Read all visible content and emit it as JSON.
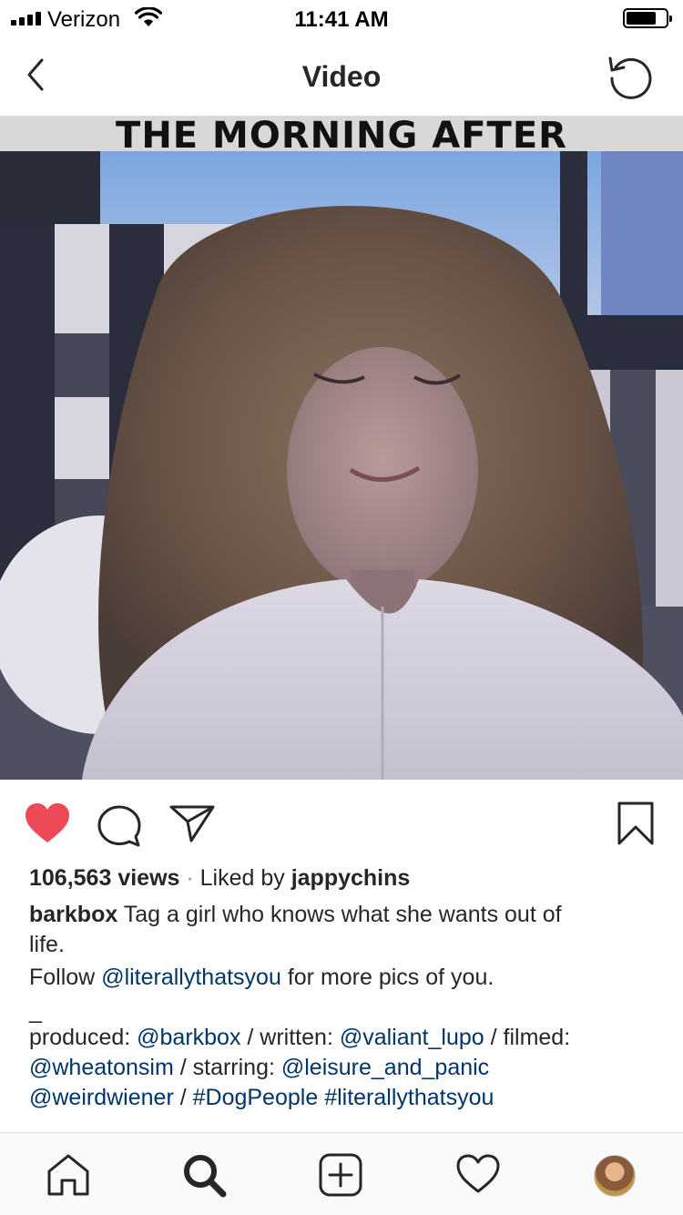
{
  "status_bar": {
    "carrier": "Verizon",
    "time": "11:41 AM",
    "battery_level": 0.75
  },
  "nav": {
    "title": "Video",
    "back_icon": "chevron-left-icon",
    "replay_icon": "replay-icon"
  },
  "video": {
    "title_text": "THE MORNING AFTER"
  },
  "post": {
    "liked": true,
    "like_color": "#ed4956",
    "views": "106,563 views",
    "separator": " · ",
    "liked_by_prefix": "Liked by ",
    "liked_by_user": "jappychins",
    "author": "barkbox",
    "caption_line1": " Tag a girl who knows what she wants out of",
    "caption_line2": "life.",
    "follow_prefix": "Follow ",
    "follow_handle": "@literallythatsyou",
    "follow_suffix": " for more pics of you.",
    "dash": "_",
    "produced_label": "produced: ",
    "produced_handle": "@barkbox",
    "written_label": " / written: ",
    "written_handle": "@valiant_lupo",
    "filmed_label": " / filmed:",
    "filmed_handle": "@wheatonsim",
    "starring_label": " / starring: ",
    "starring_handle1": "@leisure_and_panic",
    "starring_handle2": "@weirdwiener",
    "slash": " / ",
    "hashtag1": "#DogPeople",
    "hashtag2": "#literallythatsyou"
  },
  "tabs": [
    "home-icon",
    "search-icon",
    "add-post-icon",
    "activity-heart-icon",
    "profile-avatar"
  ],
  "colors": {
    "link": "#003569",
    "text": "#262626",
    "muted": "#8e8e8e"
  }
}
